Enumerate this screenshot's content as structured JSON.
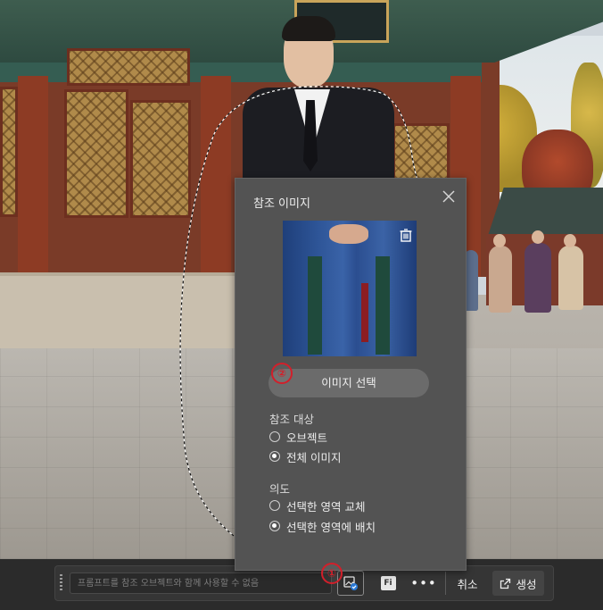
{
  "canvas": {
    "description_icons": [
      "reference-image-icon",
      "firefly-icon",
      "more-icon",
      "generate-icon"
    ]
  },
  "panel": {
    "title": "참조 이미지",
    "select_button_label": "이미지 선택",
    "target_section": {
      "label": "참조 대상",
      "options": [
        {
          "label": "오브젝트",
          "selected": false
        },
        {
          "label": "전체 이미지",
          "selected": true
        }
      ]
    },
    "intent_section": {
      "label": "의도",
      "options": [
        {
          "label": "선택한 영역 교체",
          "selected": false
        },
        {
          "label": "선택한 영역에 배치",
          "selected": true
        }
      ]
    },
    "step_badge_select": "②"
  },
  "taskbar": {
    "prompt_placeholder": "프롬프트를 참조 오브젝트와 함께 사용할 수 없음",
    "prompt_value": "",
    "fi_label": "Fi",
    "more_label": "•••",
    "cancel_label": "취소",
    "generate_label": "생성",
    "step_badge_reference": "①"
  },
  "colors": {
    "panel_bg": "#535353",
    "taskbar_bg": "#353535",
    "badge_red": "#d21f2a"
  }
}
